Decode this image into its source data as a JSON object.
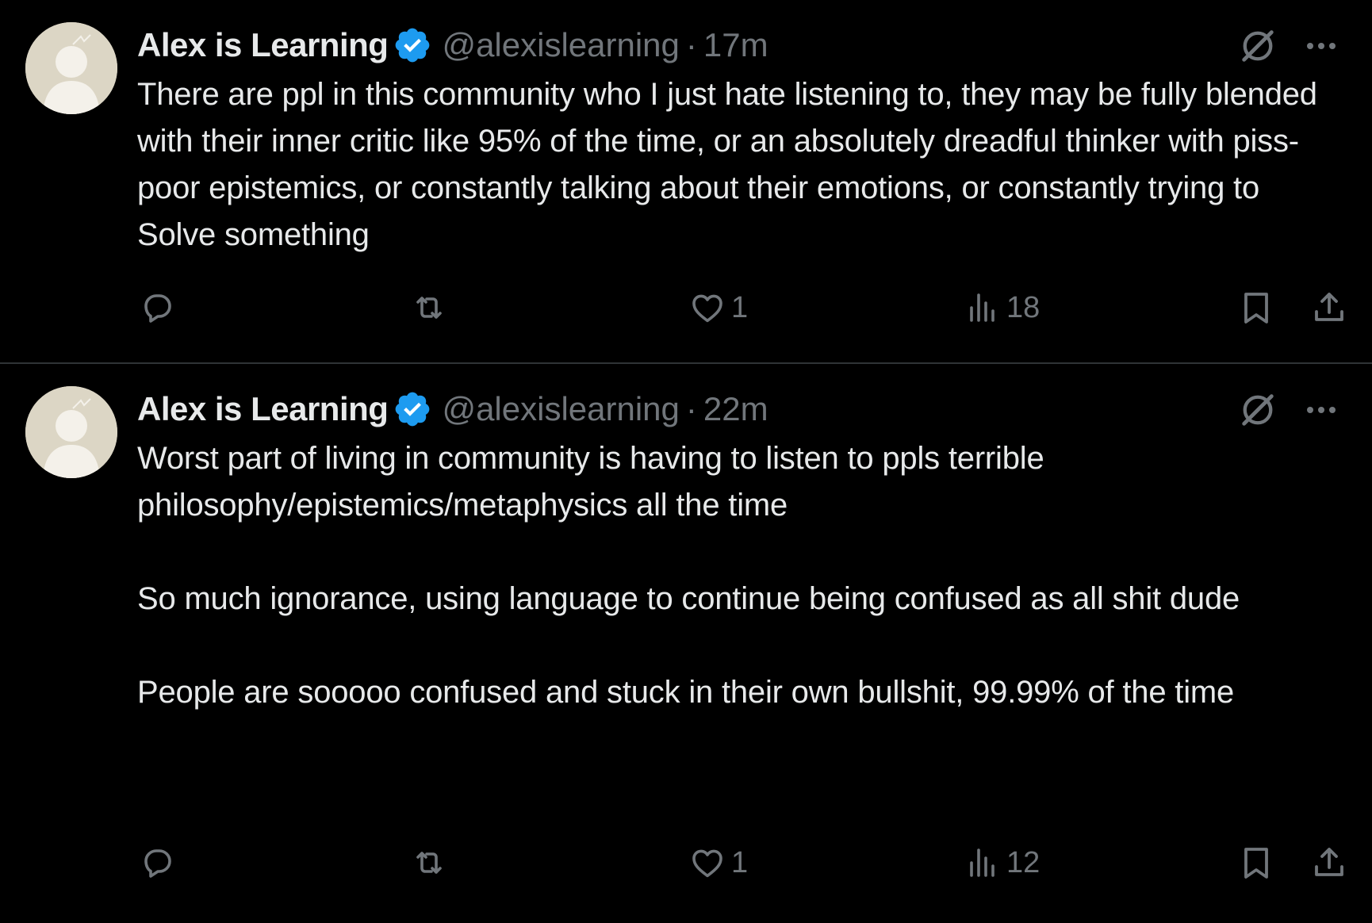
{
  "colors": {
    "background": "#000000",
    "text": "#e7e9ea",
    "secondary": "#71767b",
    "verified": "#1d9bf0",
    "divider": "#2f3336"
  },
  "tweets": [
    {
      "name": "Alex is Learning",
      "handle": "@alexislearning",
      "separator": "·",
      "time": "17m",
      "text": "There are ppl in this community who I just hate listening to, they may be fully blended with their inner critic like 95% of the time, or an absolutely dreadful thinker with piss-poor epistemics, or constantly talking about their emotions, or constantly trying to Solve something",
      "likes": "1",
      "views": "18",
      "icons": [
        "reply-icon",
        "retweet-icon",
        "heart-icon",
        "views-icon",
        "bookmark-icon",
        "share-icon"
      ]
    },
    {
      "name": "Alex is Learning",
      "handle": "@alexislearning",
      "separator": "·",
      "time": "22m",
      "text": "Worst part of living in community is having to listen to ppls terrible philosophy/epistemics/metaphysics all the time\n\nSo much ignorance, using language to continue being confused as all shit dude\n\nPeople are sooooo confused and stuck in their own bullshit, 99.99% of the time",
      "likes": "1",
      "views": "12",
      "icons": [
        "reply-icon",
        "retweet-icon",
        "heart-icon",
        "views-icon",
        "bookmark-icon",
        "share-icon"
      ]
    }
  ]
}
